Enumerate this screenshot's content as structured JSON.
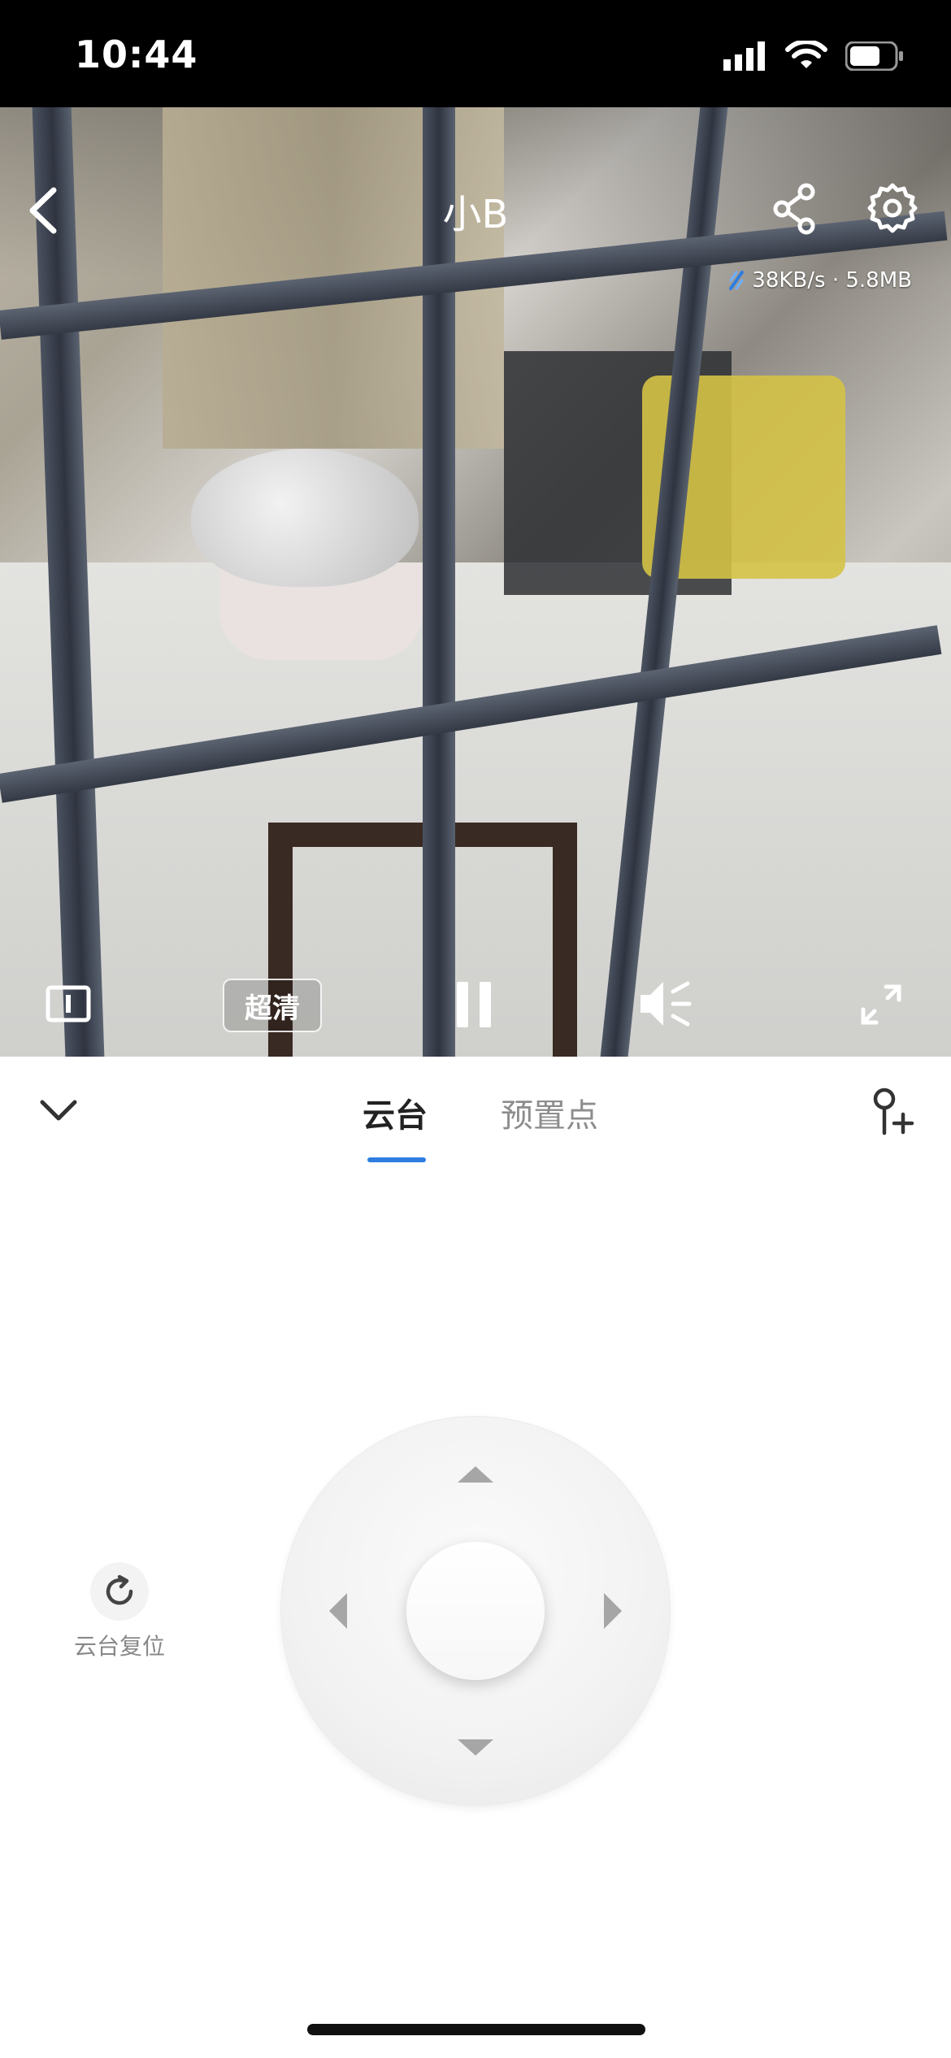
{
  "status": {
    "time": "10:44"
  },
  "header": {
    "title": "小B",
    "net_speed": "38KB/s · 5.8MB"
  },
  "player": {
    "quality_label": "超清"
  },
  "tabs": [
    {
      "label": "云台"
    },
    {
      "label": "预置点"
    }
  ],
  "ptz": {
    "reset_label": "云台复位"
  },
  "colors": {
    "accent": "#2f7de1"
  }
}
